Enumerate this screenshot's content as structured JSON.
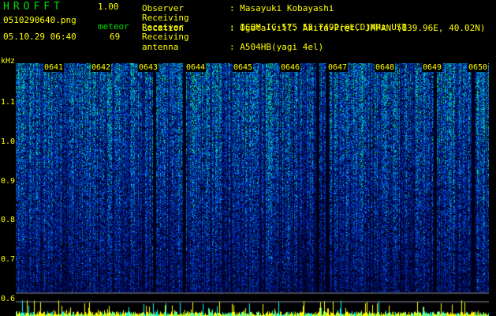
{
  "app": {
    "logo": "HROFFT",
    "version": "1.00"
  },
  "file": {
    "name": "0510290640.png",
    "datetime": "05.10.29 06:40"
  },
  "meteor": {
    "label": "meteor",
    "count": "69"
  },
  "info": [
    {
      "label": "Observer",
      "value": ": Masayuki Kobayashi"
    },
    {
      "label": "Receiving Location",
      "value": ": Ogata-vill. Akita-Pref. JAPAN (139.96E, 40.02N)"
    },
    {
      "label": "Receiver",
      "value": ": ICOM IC-575 53.7492(@LCD)MHz USB"
    },
    {
      "label": "Receiving antenna",
      "value": ": A504HB(yagi 4el)"
    }
  ],
  "axis": {
    "unit": "kHz",
    "freq_labels": [
      "1.1",
      "1.0",
      "0.9",
      "0.8",
      "0.7",
      "0.6"
    ],
    "time_labels": [
      "0641",
      "0642",
      "0643",
      "0644",
      "0645",
      "0646",
      "0647",
      "0648",
      "0649",
      "0650"
    ]
  },
  "colors": {
    "label": "#ffff00",
    "title": "#00e000",
    "bg": "#000000"
  }
}
